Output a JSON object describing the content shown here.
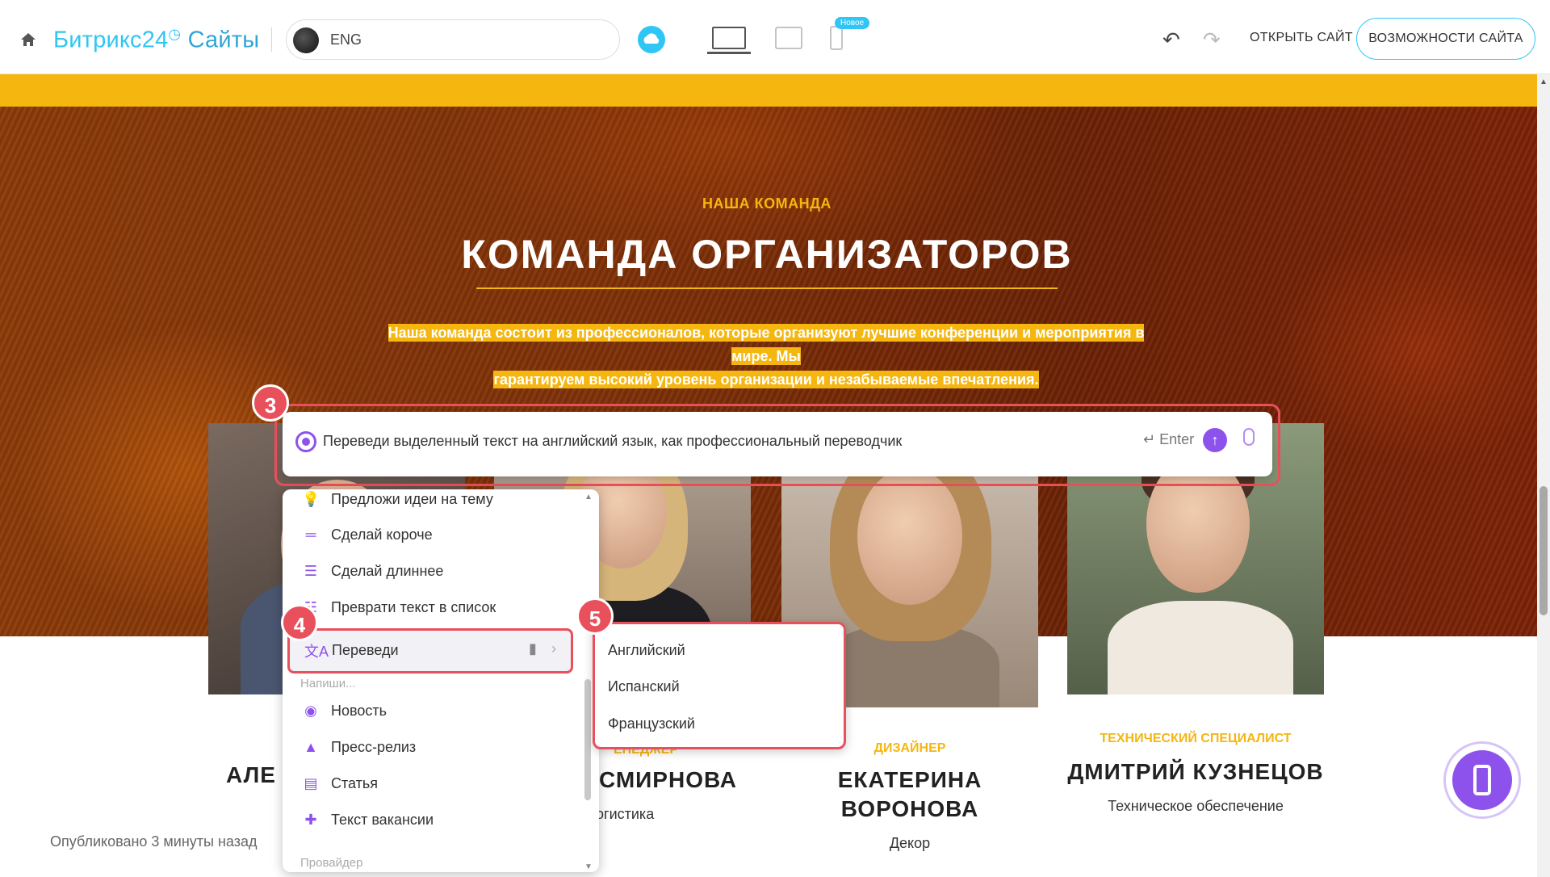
{
  "topbar": {
    "brand_prefix": "Битрикс24",
    "brand_suffix": "Сайты",
    "language": "ENG",
    "new_badge": "Новое",
    "open_site": "ОТКРЫТЬ САЙТ",
    "site_features": "ВОЗМОЖНОСТИ САЙТА"
  },
  "hero": {
    "label": "НАША КОМАНДА",
    "title": "КОМАНДА ОРГАНИЗАТОРОВ",
    "description_line1": "Наша команда состоит из профессионалов, которые организуют лучшие конференции и мероприятия в мире. Мы",
    "description_line2": "гарантируем высокий уровень организации и незабываемые впечатления."
  },
  "team": [
    {
      "role": "",
      "name": "АЛЕ",
      "sub": ""
    },
    {
      "role": "ЕНЕДЖЕР",
      "name": "СМИРНОВА",
      "sub": "огистика"
    },
    {
      "role": "ДИЗАЙНЕР",
      "name": "ЕКАТЕРИНА ВОРОНОВА",
      "sub": "Декор"
    },
    {
      "role": "ТЕХНИЧЕСКИЙ СПЕЦИАЛИСТ",
      "name": "ДМИТРИЙ КУЗНЕЦОВ",
      "sub": "Техническое обеспечение"
    }
  ],
  "published": "Опубликовано 3 минуты назад",
  "ai_prompt": {
    "text": "Переведи выделенный текст на английский язык, как профессиональный переводчик",
    "enter_hint": "Enter"
  },
  "steps": {
    "s3": "3",
    "s4": "4",
    "s5": "5"
  },
  "menu": {
    "items": [
      {
        "label": "Предложи идеи на тему",
        "icon": "lightbulb-icon"
      },
      {
        "label": "Сделай короче",
        "icon": "short-lines-icon"
      },
      {
        "label": "Сделай длиннее",
        "icon": "long-lines-icon"
      },
      {
        "label": "Преврати текст в список",
        "icon": "list-icon"
      },
      {
        "label": "Переведи",
        "icon": "translate-icon"
      }
    ],
    "group_write": "Напиши...",
    "write_items": [
      {
        "label": "Новость",
        "icon": "broadcast-icon"
      },
      {
        "label": "Пресс-релиз",
        "icon": "bell-icon"
      },
      {
        "label": "Статья",
        "icon": "document-icon"
      },
      {
        "label": "Текст вакансии",
        "icon": "add-user-icon"
      }
    ],
    "group_provider": "Провайдер"
  },
  "submenu": {
    "items": [
      "Английский",
      "Испанский",
      "Французский"
    ]
  },
  "colors": {
    "accent": "#f5b610",
    "brand": "#2fc6f6",
    "ai": "#8e52ec",
    "highlight": "#e8505b"
  }
}
